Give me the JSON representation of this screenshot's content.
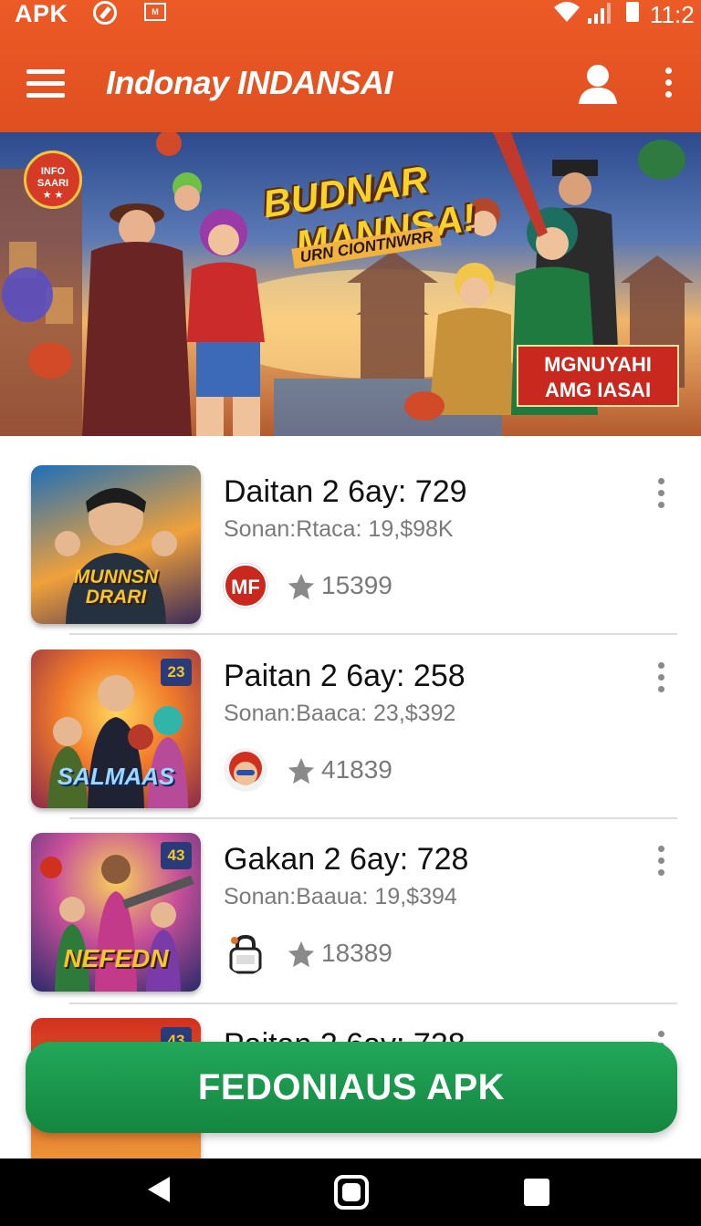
{
  "status_bar": {
    "carrier_label": "APK",
    "gallery_glyph": "M",
    "time": "11:2",
    "icons": [
      "compass-icon",
      "gallery-icon",
      "wifi-icon",
      "signal-icon",
      "battery-icon"
    ]
  },
  "app_bar": {
    "title": "Indonay INDANSAI",
    "icons": [
      "menu-icon",
      "profile-icon",
      "more-vert-icon"
    ]
  },
  "banner": {
    "badge_line1": "INFO SAARI",
    "badge_line2": "★ ★",
    "headline_line1": "BUDNAR",
    "headline_line2": "MANNSA!",
    "subline": "URN CIONTNWRR",
    "promo_line1": "MGNUYAHI",
    "promo_line2": "AMG IASAI"
  },
  "list": {
    "items": [
      {
        "title": "Daitan 2 6ay: 729",
        "subtitle": "Sonan:Rtaca: 19,$98K",
        "rating": "15399",
        "publisher_label": "MF",
        "thumb_title": "MUNNSN DRARI",
        "thumb_badge": ""
      },
      {
        "title": "Paitan 2 6ay: 258",
        "subtitle": "Sonan:Baaca: 23,$392",
        "rating": "41839",
        "publisher_label": "",
        "thumb_title": "SALMAAS",
        "thumb_badge": "23"
      },
      {
        "title": "Gakan 2 6ay: 728",
        "subtitle": "Sonan:Baaua: 19,$394",
        "rating": "18389",
        "publisher_label": "",
        "thumb_title": "NEFEDN",
        "thumb_badge": "43"
      },
      {
        "title": "Paitan 2 6ay: 728",
        "subtitle": "",
        "rating": "",
        "publisher_label": "",
        "thumb_title": "",
        "thumb_badge": "43"
      }
    ]
  },
  "cta": {
    "label": "FEDONIAUS APK"
  },
  "nav_bar": {
    "icons": [
      "back-icon",
      "home-icon",
      "recents-icon"
    ]
  },
  "colors": {
    "header": "#e8562a",
    "cta": "#1a9a4c",
    "rating_star": "#8a8a8a"
  }
}
